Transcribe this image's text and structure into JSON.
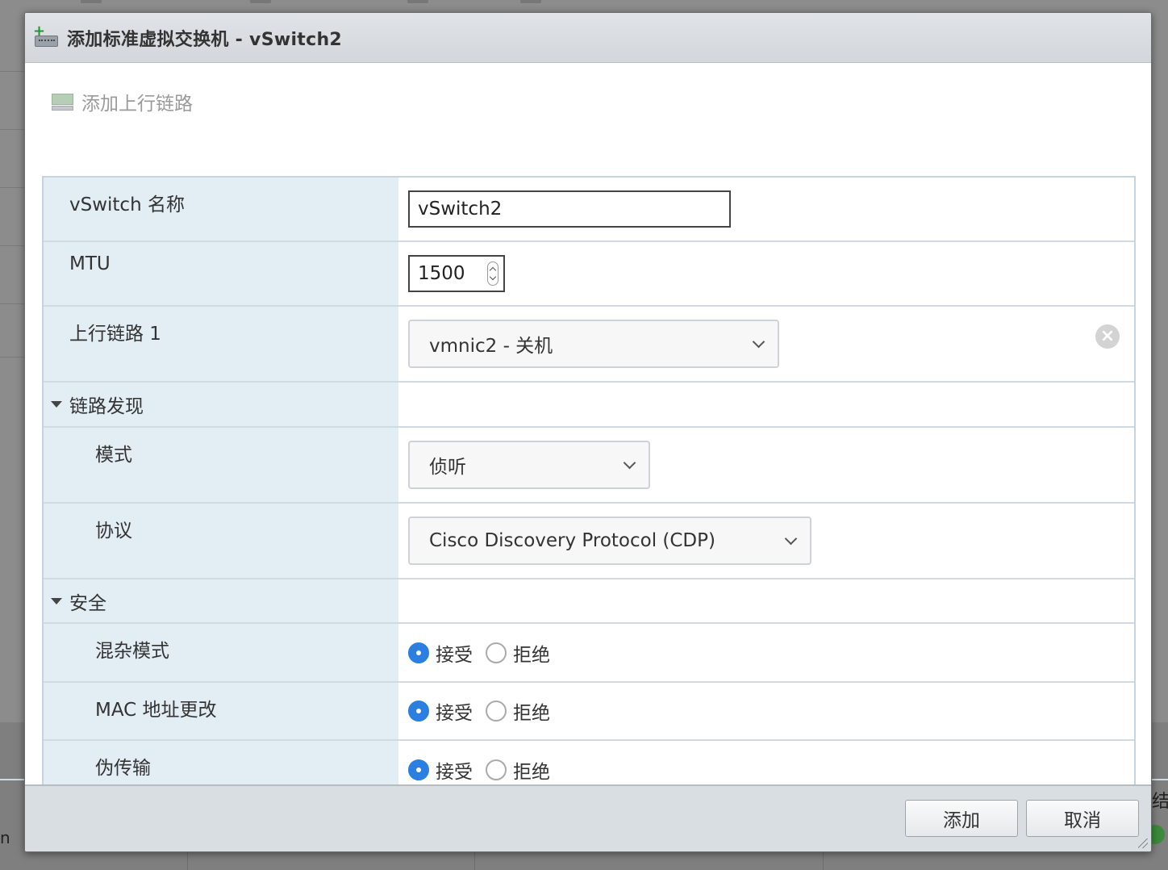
{
  "dialog": {
    "title": "添加标准虚拟交换机 - vSwitch2",
    "title_icon": "add-switch-icon"
  },
  "toolbar": {
    "add_uplink_label": "添加上行链路",
    "add_uplink_icon": "uplink-icon"
  },
  "form": {
    "vswitch_name": {
      "label": "vSwitch 名称",
      "value": "vSwitch2"
    },
    "mtu": {
      "label": "MTU",
      "value": "1500"
    },
    "uplink1": {
      "label": "上行链路 1",
      "value": "vmnic2 - 关机"
    },
    "link_discovery": {
      "section_label": "链路发现",
      "mode": {
        "label": "模式",
        "value": "侦听"
      },
      "protocol": {
        "label": "协议",
        "value": "Cisco Discovery Protocol (CDP)"
      }
    },
    "security": {
      "section_label": "安全",
      "promiscuous_mode": {
        "label": "混杂模式",
        "selected": "接受"
      },
      "mac_address_changes": {
        "label": "MAC 地址更改",
        "selected": "接受"
      },
      "forged_transmits": {
        "label": "伪传输",
        "selected": "接受"
      }
    },
    "radio_options": {
      "accept": "接受",
      "reject": "拒绝"
    }
  },
  "footer": {
    "add_label": "添加",
    "cancel_label": "取消"
  },
  "background": {
    "right_edge_text": "结果",
    "left_edge_text": "n"
  },
  "colors": {
    "label_column_bg": "#e3edf4",
    "radio_selected": "#2b7fe0",
    "title_bar_bg": "#d3d7dc",
    "footer_bg": "#d9dee3"
  }
}
